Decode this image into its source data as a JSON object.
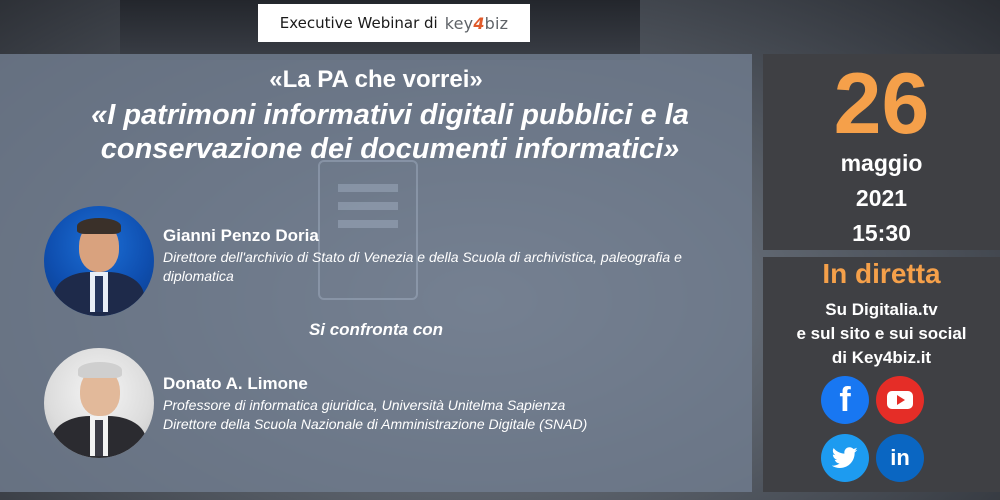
{
  "badge": {
    "label": "Executive Webinar di",
    "brand_prefix": "key",
    "brand_four": "4",
    "brand_suffix": "biz"
  },
  "titles": {
    "line1": "«La PA che vorrei»",
    "line2": "«I patrimoni informativi digitali pubblici e la conservazione dei documenti informatici»"
  },
  "speakers": [
    {
      "name": "Gianni Penzo Doria",
      "role": "Direttore dell'archivio di Stato di Venezia e della Scuola di archivistica, paleografia e diplomatica"
    },
    {
      "name": "Donato A. Limone",
      "role_line1": "Professore di informatica giuridica, Università Unitelma Sapienza",
      "role_line2": "Direttore della Scuola Nazionale di Amministrazione Digitale (SNAD)"
    }
  ],
  "versus": "Si confronta con",
  "date": {
    "day": "26",
    "month": "maggio",
    "year": "2021",
    "time": "15:30"
  },
  "live": {
    "title": "In diretta",
    "line1": "Su Digitalia.tv",
    "line2": "e sul sito e sui social",
    "line3": "di Key4biz.it"
  },
  "social": {
    "facebook_glyph": "f",
    "linkedin_glyph": "in",
    "icons": [
      "facebook-icon",
      "youtube-icon",
      "twitter-icon",
      "linkedin-icon"
    ]
  },
  "colors": {
    "accent": "#f5a04a",
    "panel": "#3f4044",
    "main_overlay": "#707c8f"
  }
}
